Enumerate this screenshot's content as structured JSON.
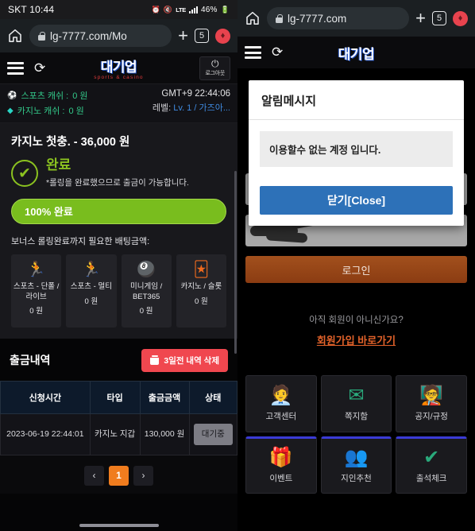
{
  "left": {
    "statusbar": {
      "carrier_time": "SKT 10:44",
      "battery": "46%",
      "network": "LTE"
    },
    "toolbar": {
      "url": "lg-7777.com/Mo",
      "tab_count": "5",
      "home_icon": "home-icon",
      "new_tab_icon": "plus-icon"
    },
    "site_header": {
      "logo_main": "대기업",
      "logo_sub": "sports & casino",
      "logout_label": "로그아웃",
      "power_glyph": "⏻",
      "refresh_glyph": "⟳"
    },
    "cash": {
      "rows": [
        {
          "icon": "soccer-ball-icon",
          "glyph": "⚽",
          "label": "스포츠 캐쉬 :",
          "value": "0 원"
        },
        {
          "icon": "diamond-icon",
          "glyph": "◆",
          "label": "카지노 캐쉬 :",
          "value": "0 원"
        }
      ],
      "time": "GMT+9 22:44:06",
      "level_label": "레벨:",
      "level_value": "Lv. 1 / 가즈아..."
    },
    "rolling": {
      "title": "카지노 첫충. - 36,000 원",
      "status_main": "완료",
      "status_sub": "*롤링을 완료했으므로 출금이 가능합니다.",
      "progress_label": "100% 완료",
      "progress_percent": 100,
      "need_label": "보너스 롤링완료까지 필요한 배팅금액:",
      "categories": [
        {
          "icon": "runner-icon",
          "glyph": "🏃",
          "label": "스포츠 - 단폴 / 라이브",
          "amount": "0 원"
        },
        {
          "icon": "runner-icon",
          "glyph": "🏃",
          "label": "스포츠 - 멀티",
          "amount": "0 원"
        },
        {
          "icon": "eight-ball-icon",
          "glyph": "🎱",
          "label": "미니게임 / BET365",
          "amount": "0 원"
        },
        {
          "icon": "cards-icon",
          "glyph": "🃏",
          "label": "카지노 / 슬롯",
          "amount": "0 원"
        }
      ]
    },
    "history": {
      "title": "출금내역",
      "delete_button": "3일전 내역 삭제",
      "delete_icon": "trash-icon",
      "columns": [
        "신청시간",
        "타입",
        "출금금액",
        "상태"
      ],
      "rows": [
        {
          "time": "2023-06-19 22:44:01",
          "type": "카지노 지갑",
          "amount": "130,000 원",
          "state": "대기중"
        }
      ],
      "pager": {
        "prev": "‹",
        "next": "›",
        "pages": [
          "1"
        ],
        "current": "1"
      }
    }
  },
  "right": {
    "toolbar": {
      "url": "lg-7777.com",
      "tab_count": "5"
    },
    "site_header": {
      "logo_main": "대기업"
    },
    "modal": {
      "title": "알림메시지",
      "message": "이용할수 없는 계정 입니다.",
      "close_button": "닫기[Close]"
    },
    "login": {
      "id_placeholder": "",
      "password_placeholder": "",
      "login_button": "로그인",
      "signup_question": "아직 회원이 아니신가요?",
      "signup_link": "회원가입 바로가기"
    },
    "tiles": [
      {
        "icon": "headset-agent-icon",
        "glyph": "🧑‍💼",
        "label": "고객센터",
        "accent": false
      },
      {
        "icon": "envelope-icon",
        "glyph": "✉",
        "label": "쪽지함",
        "accent": false
      },
      {
        "icon": "presenter-board-icon",
        "glyph": "🧑‍🏫",
        "label": "공지/규정",
        "accent": false
      },
      {
        "icon": "gift-icon",
        "glyph": "🎁",
        "label": "이벤트",
        "accent": true
      },
      {
        "icon": "two-people-icon",
        "glyph": "👥",
        "label": "지인추천",
        "accent": true
      },
      {
        "icon": "person-check-icon",
        "glyph": "✔",
        "label": "출석체크",
        "accent": true
      }
    ]
  },
  "colors": {
    "accent_orange": "#f07c1e",
    "green": "#8bc220",
    "red": "#f0474f",
    "blue": "#2d71b8",
    "teal": "#2aa97b"
  }
}
